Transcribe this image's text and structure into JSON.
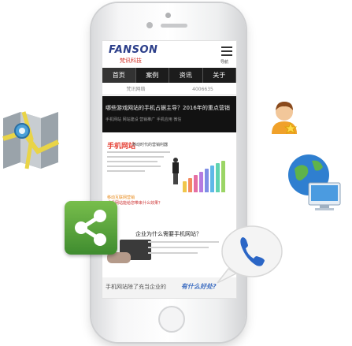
{
  "app": {
    "logo_text": "FANSON",
    "logo_sub": "梵讯科技",
    "menu_label": "导航"
  },
  "nav": {
    "tabs": [
      {
        "label": "首页"
      },
      {
        "label": "案例"
      },
      {
        "label": "资讯"
      },
      {
        "label": "关于"
      }
    ]
  },
  "subtabs": [
    {
      "label": "梵讯网络"
    },
    {
      "label": "4006635"
    }
  ],
  "banner": {
    "line1": "哪些游戏网站的手机占据主导？2016年的重点营销",
    "line2": "手机网站 网站建设 营销推广 手机应用 微信"
  },
  "content": {
    "section_title": "手机网站",
    "section_sub": "移动时代的营销利器",
    "orange_line1": "移动互联网营销",
    "orange_line2": "手机网站能给您带来什么效果？",
    "question_title": "企业为什么需要手机网站？"
  },
  "footer": {
    "text": "手机网站除了充当企业的",
    "highlight": "有什么好处?"
  },
  "colors": {
    "brand_blue": "#2c3f8a",
    "accent_red": "#e6453a",
    "nav_bg": "#1c1c1c",
    "share_green": "#4e9e38",
    "phone_blue": "#2b66c6"
  },
  "icons": [
    "map-icon",
    "share-icon",
    "user-icon",
    "globe-icon",
    "phone-call-icon",
    "menu-icon"
  ]
}
